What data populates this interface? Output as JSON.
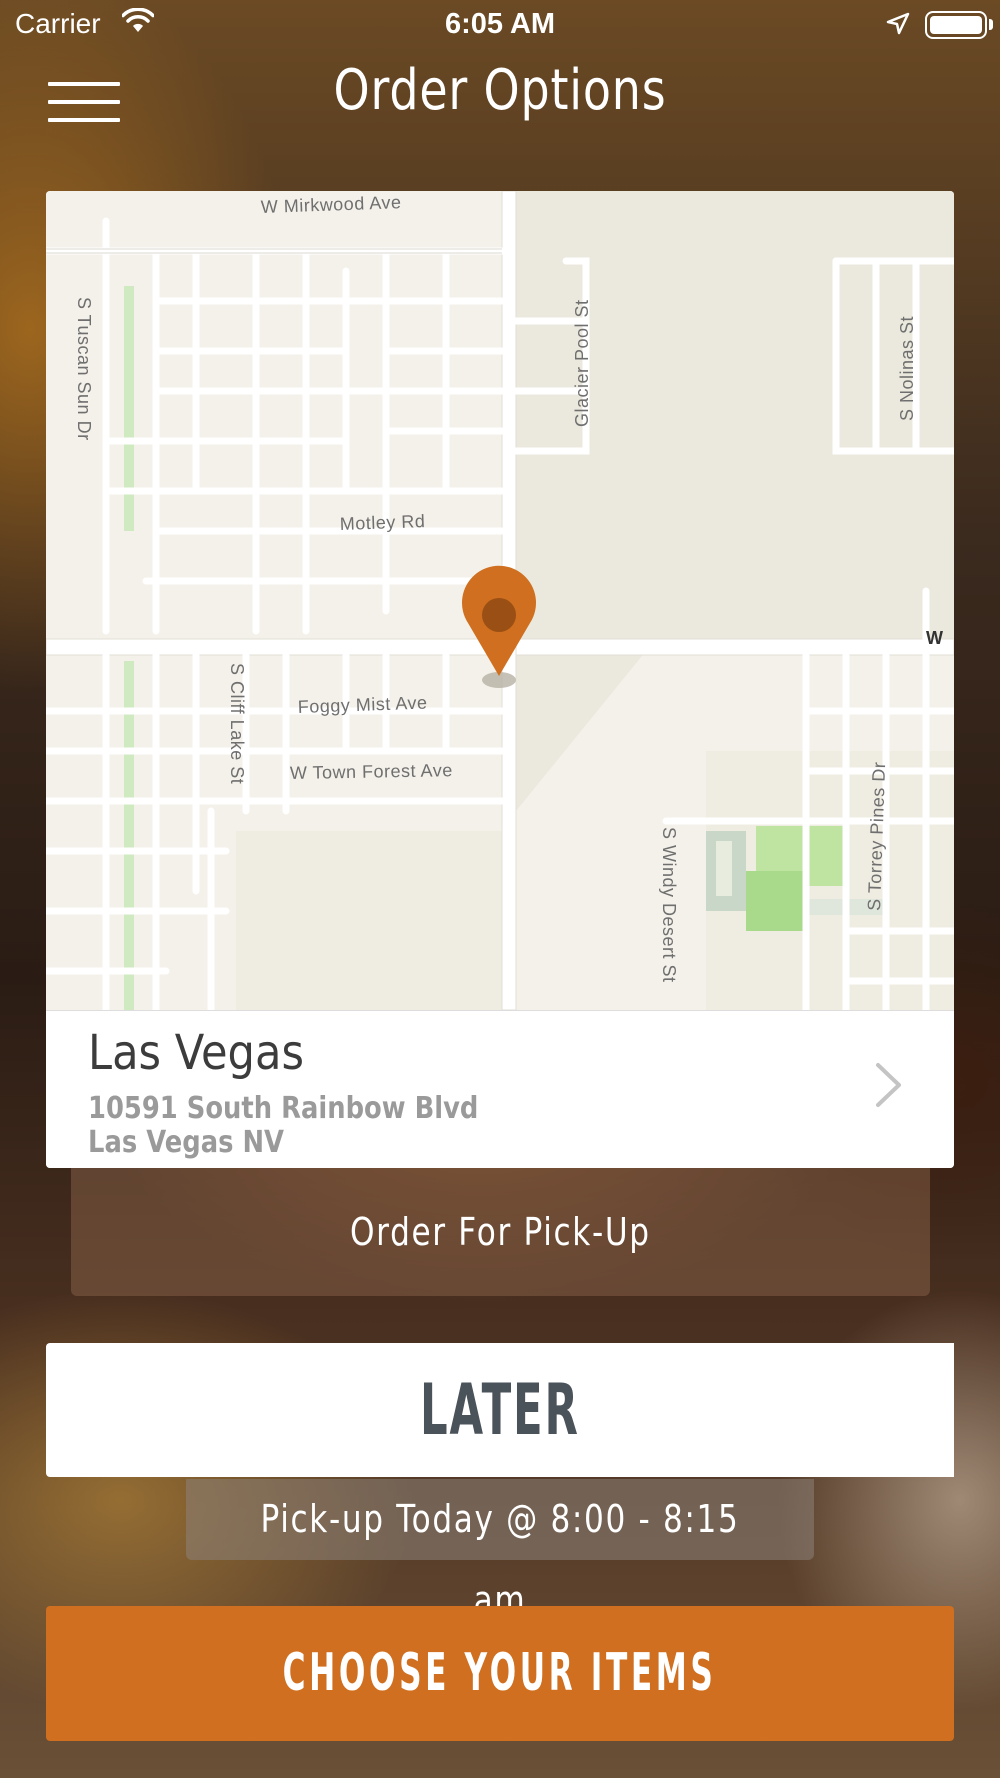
{
  "status_bar": {
    "carrier": "Carrier",
    "time": "6:05 AM",
    "wifi_icon": "wifi-icon",
    "location_icon": "location-arrow-icon",
    "battery_icon": "battery-full-icon"
  },
  "nav": {
    "title": "Order Options",
    "menu_icon": "hamburger-menu-icon"
  },
  "map": {
    "pin_icon": "map-pin-icon",
    "pin_color": "#cf6f1f",
    "labels": {
      "mirkwood": "W Mirkwood Ave",
      "tuscan": "S Tuscan Sun Dr",
      "glacier": "Glacier Pool St",
      "nolinas": "S Nolinas St",
      "motley": "Motley Rd",
      "edge_w": "W",
      "cliff_lake": "S Cliff Lake St",
      "foggy_mist": "Foggy Mist Ave",
      "town_forest": "W Town Forest Ave",
      "windy_desert": "S Windy Desert St",
      "torrey_pines": "S Torrey Pines Dr"
    }
  },
  "location": {
    "name": "Las Vegas",
    "address_line1": "10591 South Rainbow Blvd",
    "address_line2": "Las Vegas NV",
    "chevron_icon": "chevron-right-icon"
  },
  "order_type": {
    "label": "Order For Pick-Up"
  },
  "timing": {
    "label": "LATER",
    "pickup_time": "Pick-up Today @ 8:00 - 8:15 am"
  },
  "cta": {
    "label": "CHOOSE YOUR ITEMS",
    "color": "#cf6f1f"
  }
}
